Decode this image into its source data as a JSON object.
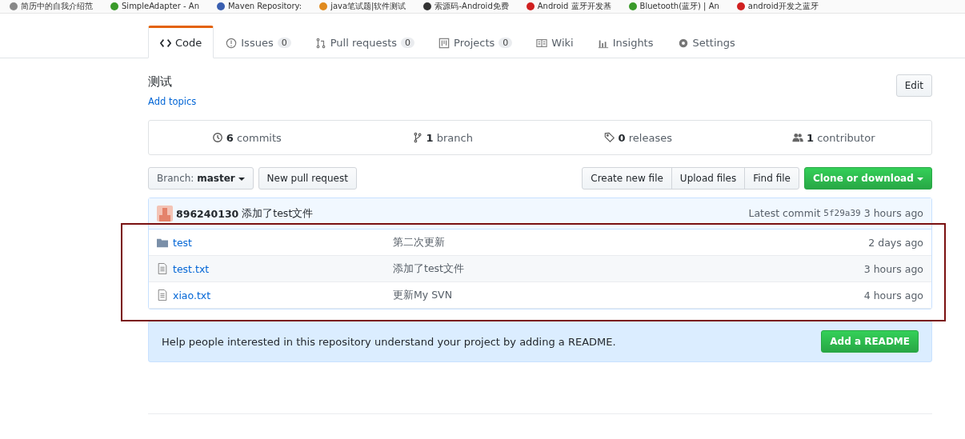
{
  "bookmarks": [
    {
      "label": "简历中的自我介绍范",
      "color": "#888888"
    },
    {
      "label": "SimpleAdapter - An",
      "color": "#3a9a2a"
    },
    {
      "label": "Maven Repository: ",
      "color": "#3a5fb0"
    },
    {
      "label": "java笔试题|软件测试",
      "color": "#e08a1e"
    },
    {
      "label": "索源码-Android免费",
      "color": "#333333"
    },
    {
      "label": "Android 蓝牙开发基",
      "color": "#d02020"
    },
    {
      "label": "Bluetooth(蓝牙) | An",
      "color": "#3a9a2a"
    },
    {
      "label": "android开发之蓝牙",
      "color": "#d02020"
    }
  ],
  "tabs": [
    {
      "kind": "code",
      "label": "Code",
      "selected": true
    },
    {
      "kind": "issues",
      "label": "Issues",
      "count": "0",
      "selected": false
    },
    {
      "kind": "pulls",
      "label": "Pull requests",
      "count": "0",
      "selected": false
    },
    {
      "kind": "projects",
      "label": "Projects",
      "count": "0",
      "selected": false
    },
    {
      "kind": "wiki",
      "label": "Wiki",
      "selected": false
    },
    {
      "kind": "insights",
      "label": "Insights",
      "selected": false
    },
    {
      "kind": "settings",
      "label": "Settings",
      "selected": false
    }
  ],
  "repo": {
    "description": "测试",
    "topics_link": "Add topics",
    "edit_button": "Edit"
  },
  "summary": [
    {
      "kind": "commits",
      "count": "6",
      "label": "commits"
    },
    {
      "kind": "branch",
      "count": "1",
      "label": "branch"
    },
    {
      "kind": "releases",
      "count": "0",
      "label": "releases"
    },
    {
      "kind": "contributors",
      "count": "1",
      "label": "contributor"
    }
  ],
  "toolbar": {
    "branch_label": "Branch:",
    "branch": "master",
    "new_pr": "New pull request",
    "actions": [
      "Create new file",
      "Upload files",
      "Find file"
    ],
    "clone": "Clone or download"
  },
  "latest_commit": {
    "author": "896240130",
    "message": "添加了test文件",
    "prefix": "Latest commit",
    "sha": "5f29a39",
    "age": "3 hours ago"
  },
  "files": [
    {
      "kind": "folder",
      "name": "test",
      "message": "第二次更新",
      "age": "2 days ago"
    },
    {
      "kind": "file",
      "name": "test.txt",
      "message": "添加了test文件",
      "age": "3 hours ago"
    },
    {
      "kind": "file",
      "name": "xiao.txt",
      "message": "更新My SVN",
      "age": "4 hours ago"
    }
  ],
  "readme_notice": {
    "text": "Help people interested in this repository understand your project by adding a README.",
    "button": "Add a README"
  }
}
